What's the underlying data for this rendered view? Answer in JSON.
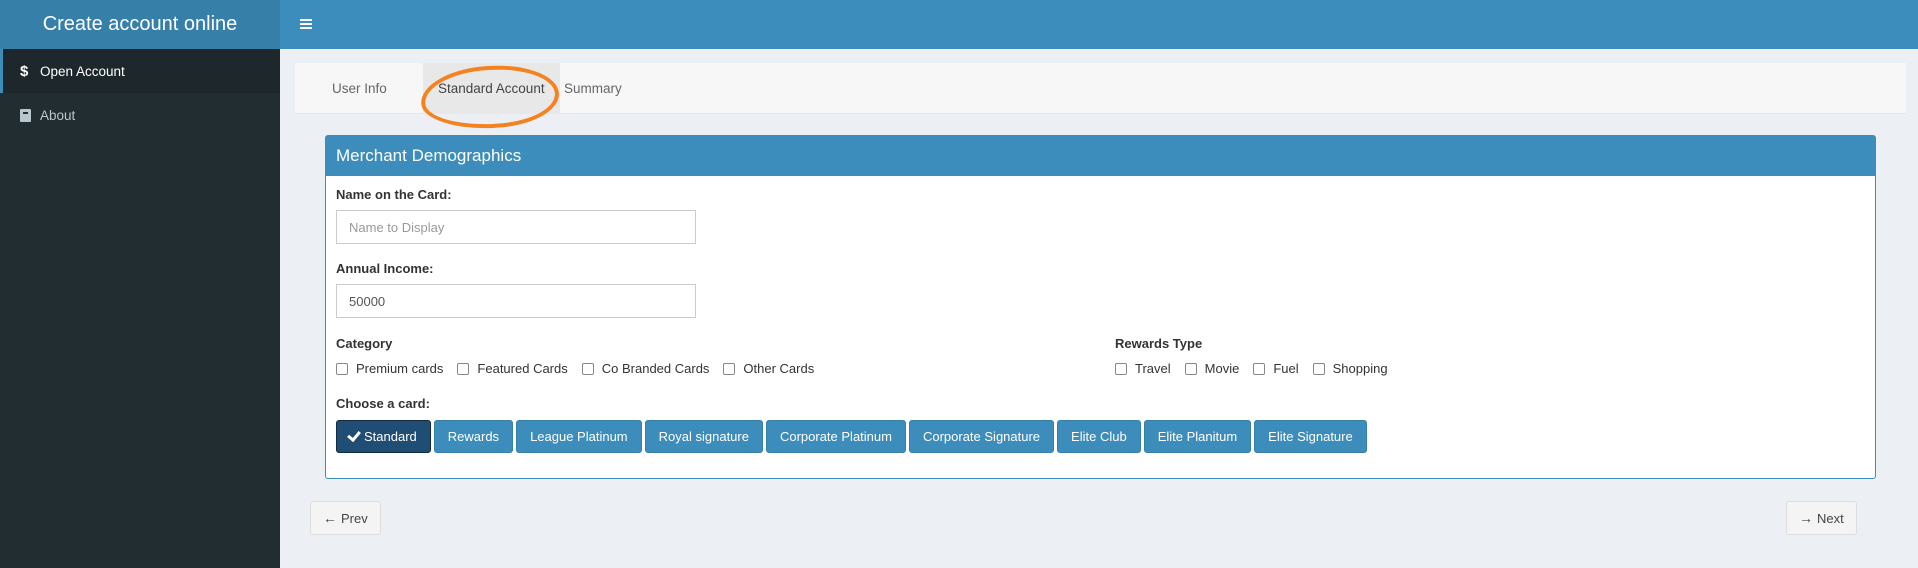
{
  "app": {
    "title": "Create account online"
  },
  "header": {
    "toggle_icon": "hamburger-icon"
  },
  "sidebar": {
    "items": [
      {
        "label": "Open Account",
        "icon": "dollar-icon",
        "active": true
      },
      {
        "label": "About",
        "icon": "book-icon",
        "active": false
      }
    ]
  },
  "tabs": [
    {
      "label": "User Info",
      "active": false
    },
    {
      "label": "Standard Account",
      "active": true
    },
    {
      "label": "Summary",
      "active": false
    }
  ],
  "panel": {
    "title": "Merchant Demographics",
    "name_label": "Name on the Card:",
    "name_placeholder": "Name to Display",
    "name_value": "",
    "income_label": "Annual Income:",
    "income_value": "50000",
    "category_label": "Category",
    "categories": [
      "Premium cards",
      "Featured Cards",
      "Co Branded Cards",
      "Other Cards"
    ],
    "rewards_label": "Rewards Type",
    "rewards": [
      "Travel",
      "Movie",
      "Fuel",
      "Shopping"
    ],
    "choose_label": "Choose a card:",
    "cards": [
      "Standard",
      "Rewards",
      "League Platinum",
      "Royal signature",
      "Corporate Platinum",
      "Corporate Signature",
      "Elite Club",
      "Elite Planitum",
      "Elite Signature"
    ],
    "selected_card": "Standard"
  },
  "nav": {
    "prev_label": "Prev",
    "next_label": "Next"
  },
  "colors": {
    "header": "#3c8dbc",
    "logo": "#367fa9",
    "sidebar": "#222d32",
    "annotation": "#f58220",
    "selected_button": "#204d74"
  }
}
